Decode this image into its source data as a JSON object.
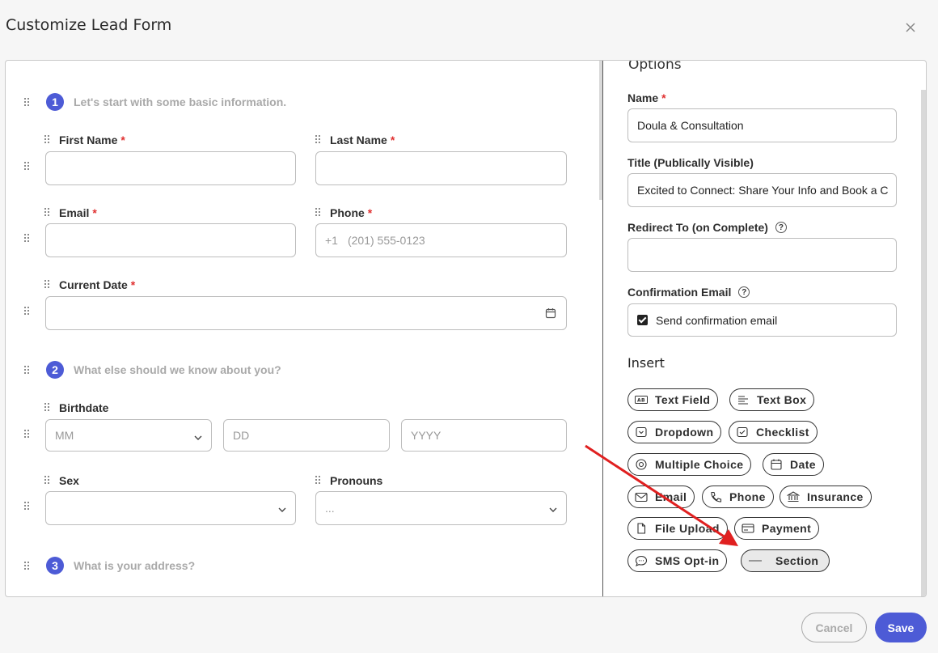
{
  "modal": {
    "title": "Customize Lead Form"
  },
  "form": {
    "steps": [
      {
        "num": "1",
        "text": "Let's start with some basic information."
      },
      {
        "num": "2",
        "text": "What else should we know about you?"
      },
      {
        "num": "3",
        "text": "What is your address?"
      }
    ],
    "fields": {
      "first_name": "First Name",
      "last_name": "Last Name",
      "email": "Email",
      "phone": "Phone",
      "phone_prefix": "+1",
      "phone_placeholder": "(201) 555-0123",
      "current_date": "Current Date",
      "birthdate": "Birthdate",
      "mm": "MM",
      "dd": "DD",
      "yyyy": "YYYY",
      "sex": "Sex",
      "pronouns": "Pronouns",
      "pronouns_value": "...",
      "required_mark": "*"
    }
  },
  "options": {
    "heading": "Options",
    "name_label": "Name",
    "name_value": "Doula & Consultation",
    "title_label": "Title (Publically Visible)",
    "title_value": "Excited to Connect: Share Your Info and Book a C",
    "redirect_label": "Redirect To (on Complete)",
    "redirect_value": "",
    "confirmation_label": "Confirmation Email",
    "confirmation_checkbox": "Send confirmation email",
    "confirmation_checked": true,
    "help_glyph": "?"
  },
  "insert": {
    "heading": "Insert",
    "items": [
      {
        "label": "Text Field",
        "icon": "text-field-icon"
      },
      {
        "label": "Text Box",
        "icon": "text-box-icon"
      },
      {
        "label": "Dropdown",
        "icon": "dropdown-icon"
      },
      {
        "label": "Checklist",
        "icon": "checklist-icon"
      },
      {
        "label": "Multiple Choice",
        "icon": "radio-icon"
      },
      {
        "label": "Date",
        "icon": "calendar-icon"
      },
      {
        "label": "Email",
        "icon": "envelope-icon"
      },
      {
        "label": "Phone",
        "icon": "phone-icon"
      },
      {
        "label": "Insurance",
        "icon": "bank-icon"
      },
      {
        "label": "File Upload",
        "icon": "file-icon"
      },
      {
        "label": "Payment",
        "icon": "card-icon"
      },
      {
        "label": "SMS Opt-in",
        "icon": "chat-icon"
      },
      {
        "label": "Section",
        "icon": "divider-icon"
      }
    ]
  },
  "footer": {
    "cancel": "Cancel",
    "save": "Save"
  },
  "colors": {
    "accent": "#4d5bd6",
    "required": "#e03030",
    "annotation_arrow": "#e02020"
  }
}
